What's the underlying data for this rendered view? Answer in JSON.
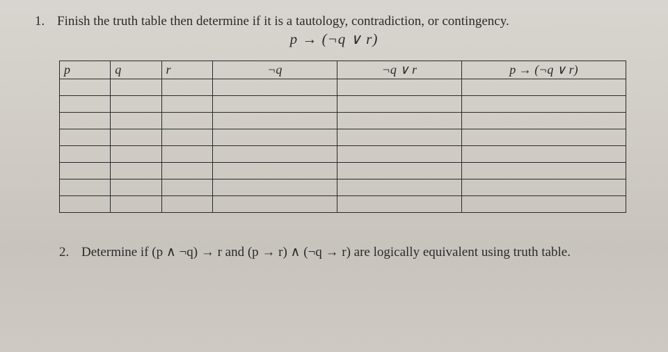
{
  "q1": {
    "number": "1.",
    "prompt": "Finish the truth table then determine if it is a tautology, contradiction, or contingency.",
    "formula": "p → (¬q ∨ r)",
    "headers": {
      "p": "p",
      "q": "q",
      "r": "r",
      "notq": "¬q",
      "notqvr": "¬q ∨ r",
      "impl": "p → (¬q ∨ r)"
    }
  },
  "q2": {
    "number": "2.",
    "prompt": "Determine if (p ∧ ¬q) → r and (p → r) ∧ (¬q → r) are logically equivalent using truth table."
  }
}
